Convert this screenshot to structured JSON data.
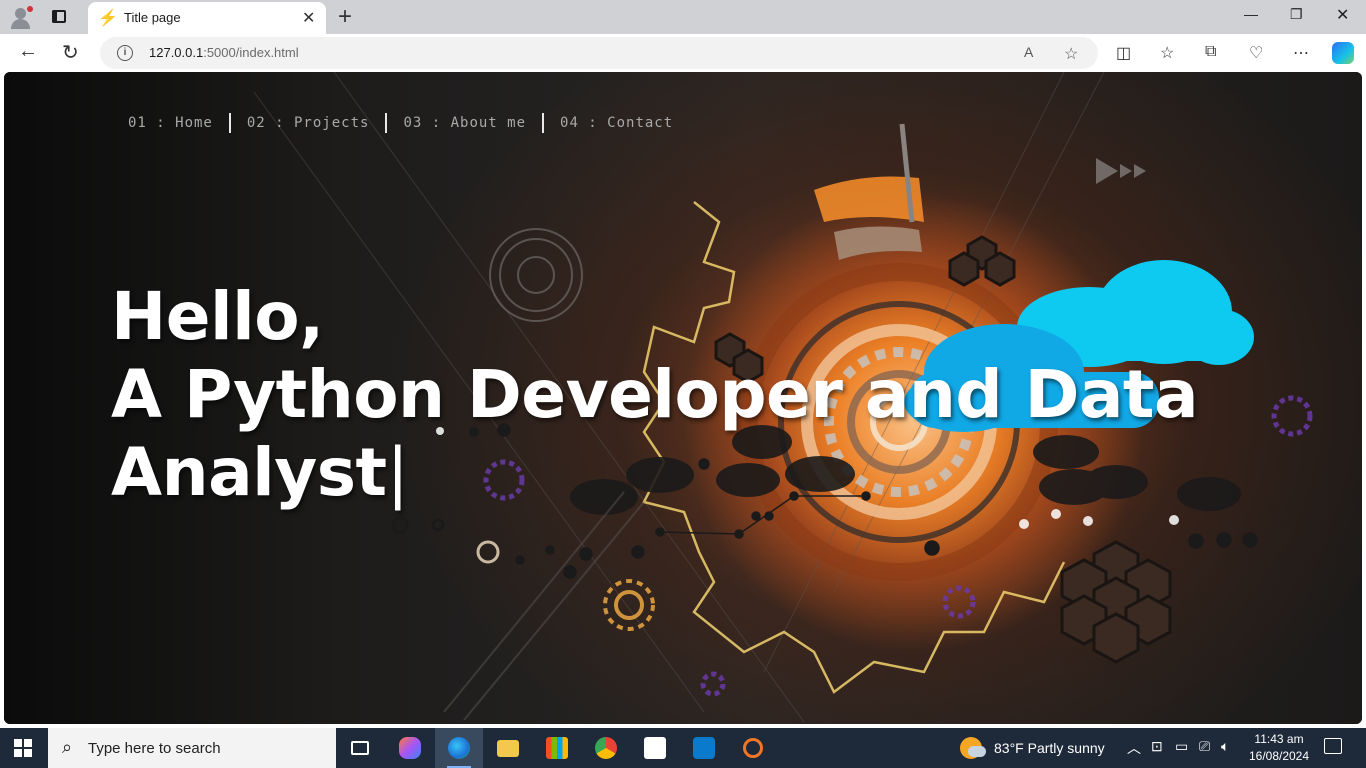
{
  "browser": {
    "tab_title": "Title page",
    "tab_favicon": "lightning-bolt-icon",
    "url_host": "127.0.0.1",
    "url_rest": ":5000/index.html"
  },
  "page": {
    "nav": [
      {
        "label": "01 : Home"
      },
      {
        "label": "02 : Projects"
      },
      {
        "label": "03 : About me"
      },
      {
        "label": "04 : Contact"
      }
    ],
    "headline_line1": "Hello,",
    "headline_line2": "A Python Developer and Data",
    "headline_line3": "Analyst",
    "cursor": "|"
  },
  "taskbar": {
    "search_placeholder": "Type here to search",
    "weather": "83°F  Partly sunny",
    "time": "11:43 am",
    "date": "16/08/2024"
  },
  "colors": {
    "accent_orange": "#f07a26",
    "cloud_cyan": "#00c8f0",
    "text_white": "#ffffff",
    "nav_gray": "#a9a9a9"
  }
}
